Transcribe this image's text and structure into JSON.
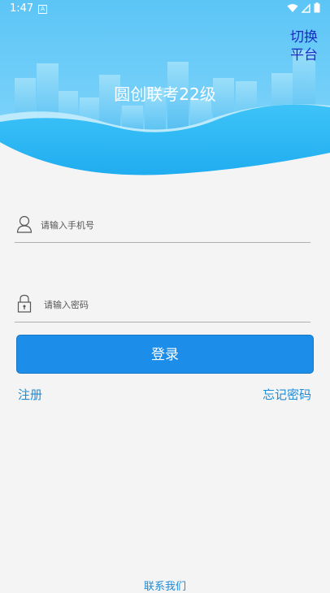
{
  "status_bar": {
    "time": "1:47",
    "notification_letter": "A"
  },
  "header": {
    "title": "圆创联考22级",
    "switch_platform": "切换\n平台"
  },
  "form": {
    "phone_placeholder": "请输入手机号",
    "password_placeholder": "请输入密码",
    "login_label": "登录"
  },
  "links": {
    "register": "注册",
    "forgot_password": "忘记密码"
  },
  "footer": {
    "contact": "联系我们"
  },
  "colors": {
    "primary": "#1c8eea",
    "link": "#1d8bd6",
    "header_sky": "#63c9f7",
    "switch_text": "#1a2cc4"
  },
  "icons": {
    "phone": "user-icon",
    "password": "lock-icon",
    "wifi": "wifi-icon",
    "signal": "signal-icon",
    "battery": "battery-icon"
  }
}
